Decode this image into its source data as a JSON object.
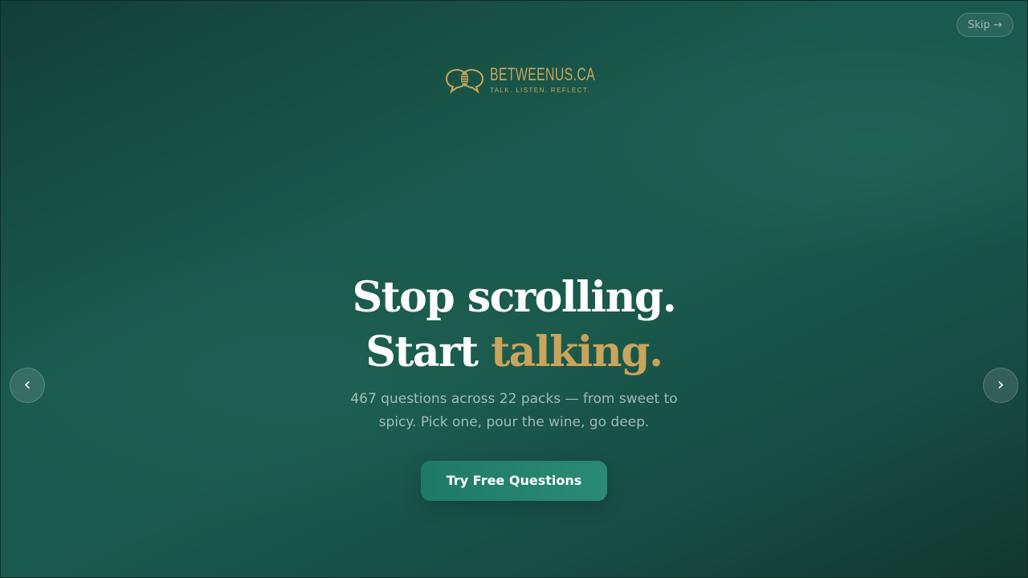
{
  "skip": {
    "label": "Skip →"
  },
  "logo": {
    "name": "BETWEENUS.CA",
    "tagline": "TALK. LISTEN. REFLECT.",
    "icon": "speech-bubbles-icon"
  },
  "hero": {
    "line1": "Stop scrolling.",
    "line2_prefix": "Start ",
    "line2_accent": "talking.",
    "subtitle_line1": "467 questions across 22 packs — from sweet to",
    "subtitle_line2": "spicy. Pick one, pour the wine, go deep.",
    "cta_label": "Try Free Questions"
  },
  "nav": {
    "prev_label": "‹",
    "next_label": "›",
    "prev_icon": "chevron-left-icon",
    "next_icon": "chevron-right-icon"
  },
  "colors": {
    "background": "#1a5a4c",
    "accent_gold": "#c9a45c",
    "cta": "#22806b"
  }
}
